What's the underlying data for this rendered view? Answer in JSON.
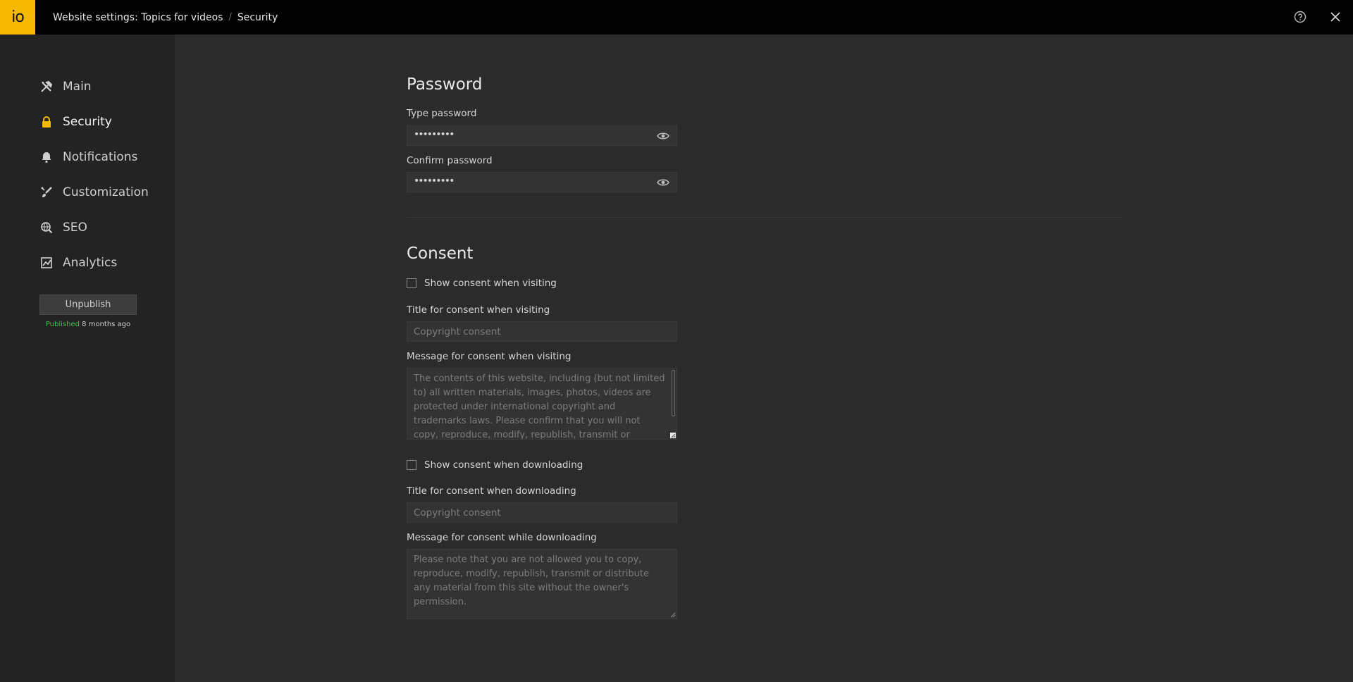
{
  "topbar": {
    "logo_text": "io",
    "breadcrumb_parent": "Website settings: Topics for videos",
    "breadcrumb_separator": "/",
    "breadcrumb_current": "Security",
    "help_icon": "help-circle-icon",
    "close_icon": "close-icon"
  },
  "sidebar": {
    "items": [
      {
        "label": "Main",
        "icon": "tools-icon",
        "active": false
      },
      {
        "label": "Security",
        "icon": "lock-icon",
        "active": true
      },
      {
        "label": "Notifications",
        "icon": "bell-icon",
        "active": false
      },
      {
        "label": "Customization",
        "icon": "brush-icon",
        "active": false
      },
      {
        "label": "SEO",
        "icon": "globe-search-icon",
        "active": false
      },
      {
        "label": "Analytics",
        "icon": "chart-icon",
        "active": false
      }
    ],
    "unpublish_label": "Unpublish",
    "published_status": "Published",
    "published_time": "8 months ago"
  },
  "password": {
    "heading": "Password",
    "type_label": "Type password",
    "type_value": "•••••••••",
    "confirm_label": "Confirm password",
    "confirm_value": "•••••••••"
  },
  "consent": {
    "heading": "Consent",
    "show_visiting_label": "Show consent when visiting",
    "title_visiting_label": "Title for consent when visiting",
    "title_visiting_placeholder": "Copyright consent",
    "message_visiting_label": "Message for consent when visiting",
    "message_visiting_placeholder": "The contents of this website, including (but not limited to) all written materials, images, photos, videos are protected under international copyright and trademarks laws. Please confirm that you will not copy, reproduce, modify, republish, transmit or distribute any",
    "show_downloading_label": "Show consent when downloading",
    "title_downloading_label": "Title for consent when downloading",
    "title_downloading_placeholder": "Copyright consent",
    "message_downloading_label": "Message for consent while downloading",
    "message_downloading_placeholder": "Please note that you are not allowed you to copy, reproduce, modify, republish, transmit or distribute any material from this site without the owner's permission."
  },
  "colors": {
    "accent": "#f5b800",
    "published_green": "#3ec24a",
    "background": "#2b2b2b",
    "sidebar": "#232323"
  }
}
